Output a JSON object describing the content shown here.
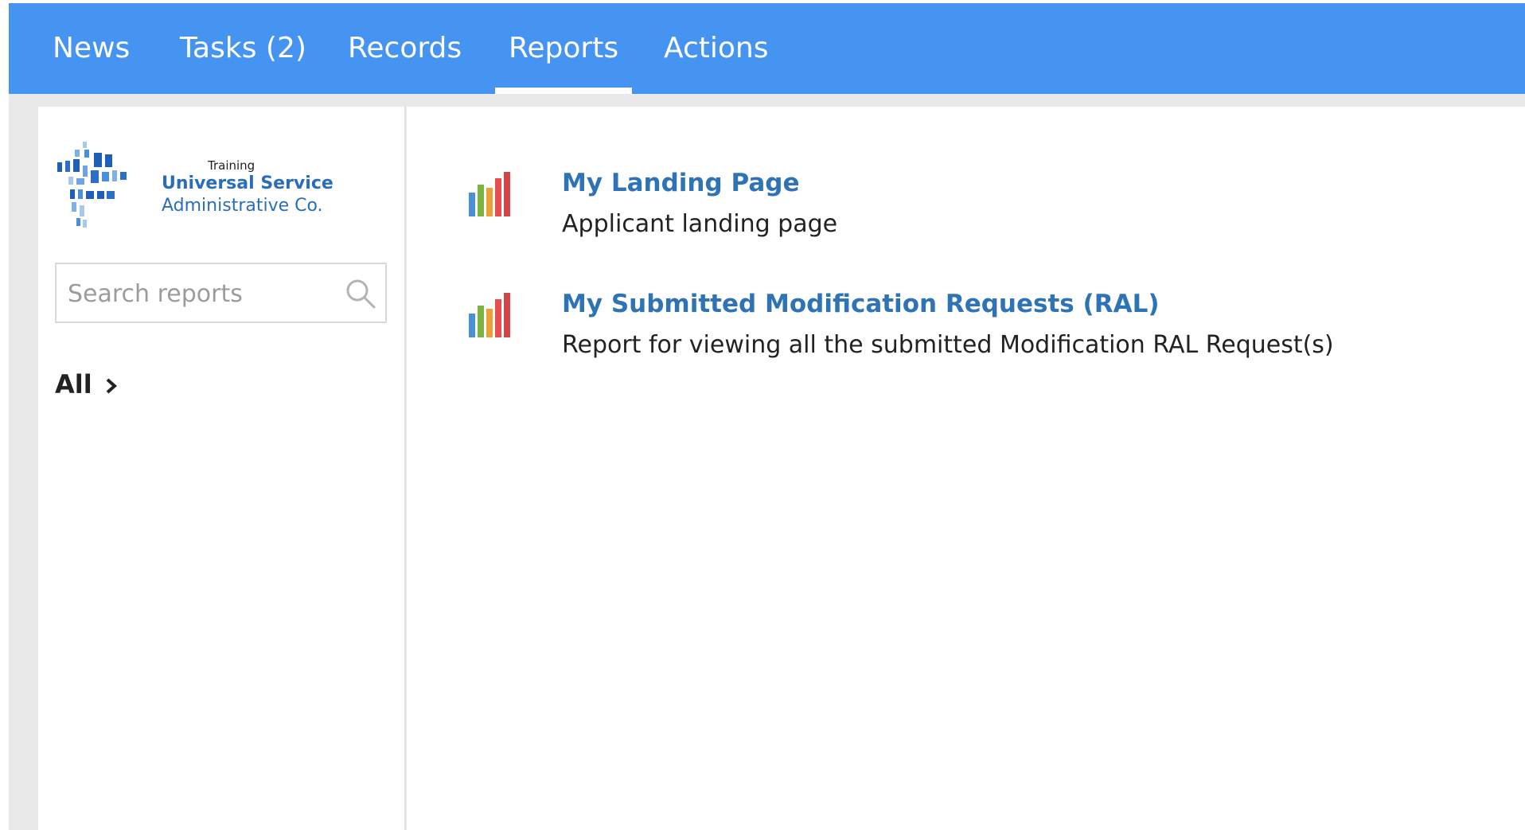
{
  "nav": {
    "tabs": [
      {
        "label": "News"
      },
      {
        "label": "Tasks (2)"
      },
      {
        "label": "Records"
      },
      {
        "label": "Reports",
        "active": true
      },
      {
        "label": "Actions"
      }
    ]
  },
  "sidebar": {
    "logo": {
      "training": "Training",
      "line1": "Universal Service",
      "line2": "Administrative Co."
    },
    "search": {
      "placeholder": "Search reports",
      "value": ""
    },
    "filter": {
      "label": "All",
      "chevron_icon": "chevron-right-icon"
    }
  },
  "reports": [
    {
      "icon": "bar-chart-icon",
      "title": "My Landing Page",
      "description": "Applicant landing page"
    },
    {
      "icon": "bar-chart-icon",
      "title": "My Submitted Modification Requests (RAL)",
      "description": "Report for viewing all the submitted Modification RAL Request(s)"
    }
  ],
  "colors": {
    "nav_background": "#4594f2",
    "link": "#2f73b7",
    "logo_blue": "#2a6ebb",
    "workspace_background": "#e9e9e9"
  }
}
